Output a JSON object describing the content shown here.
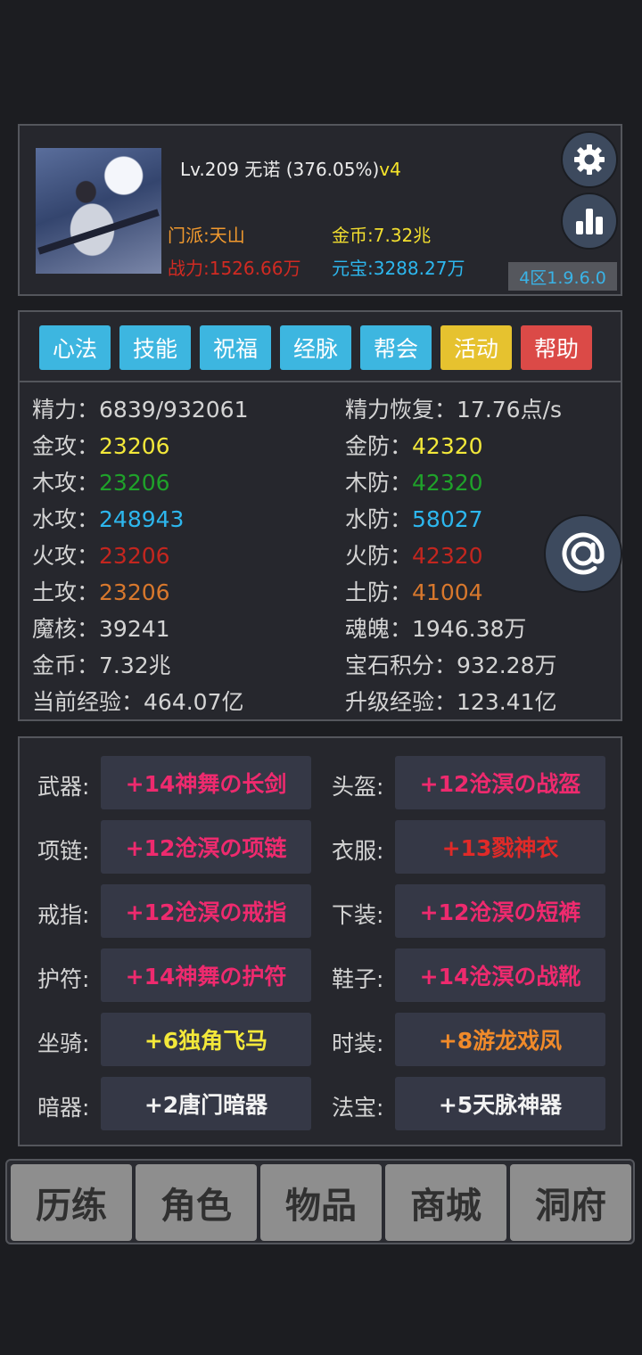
{
  "header": {
    "level": "Lv.209",
    "name": "无诺",
    "exp_pct": "(376.05%)",
    "version_tag": "v4",
    "sect": "门派:天山",
    "power": "战力:1526.66万",
    "gold": "金币:7.32兆",
    "ingot": "元宝:3288.27万",
    "server": "4区1.9.6.0"
  },
  "tabs": [
    {
      "label": "心法",
      "color": "#3db6e0"
    },
    {
      "label": "技能",
      "color": "#3db6e0"
    },
    {
      "label": "祝福",
      "color": "#3db6e0"
    },
    {
      "label": "经脉",
      "color": "#3db6e0"
    },
    {
      "label": "帮会",
      "color": "#3db6e0"
    },
    {
      "label": "活动",
      "color": "#e6c22f"
    },
    {
      "label": "帮助",
      "color": "#db4a47"
    }
  ],
  "stats": [
    {
      "label": "精力：",
      "value": "6839/932061",
      "color": "#d4d4d4"
    },
    {
      "label": "精力恢复：",
      "value": "17.76点/s",
      "color": "#d4d4d4"
    },
    {
      "label": "金攻：",
      "value": "23206",
      "color": "#f3e83a"
    },
    {
      "label": "金防：",
      "value": "42320",
      "color": "#f3e83a"
    },
    {
      "label": "木攻：",
      "value": "23206",
      "color": "#1fa22a"
    },
    {
      "label": "木防：",
      "value": "42320",
      "color": "#1fa22a"
    },
    {
      "label": "水攻：",
      "value": "248943",
      "color": "#2db7ee"
    },
    {
      "label": "水防：",
      "value": "58027",
      "color": "#2db7ee"
    },
    {
      "label": "火攻：",
      "value": "23206",
      "color": "#c3261f"
    },
    {
      "label": "火防：",
      "value": "42320",
      "color": "#c3261f"
    },
    {
      "label": "土攻：",
      "value": "23206",
      "color": "#d8782d"
    },
    {
      "label": "土防：",
      "value": "41004",
      "color": "#d8782d"
    },
    {
      "label": "魔核：",
      "value": "39241",
      "color": "#d4d4d4"
    },
    {
      "label": "魂魄：",
      "value": "1946.38万",
      "color": "#d4d4d4"
    },
    {
      "label": "金币：",
      "value": "7.32兆",
      "color": "#d4d4d4"
    },
    {
      "label": "宝石积分：",
      "value": "932.28万",
      "color": "#d4d4d4"
    },
    {
      "label": "当前经验：",
      "value": "464.07亿",
      "color": "#d4d4d4"
    },
    {
      "label": "升级经验：",
      "value": "123.41亿",
      "color": "#d4d4d4"
    }
  ],
  "equipment": [
    {
      "slot": "武器:",
      "item": "+14神舞の长剑",
      "color": "#ee2a6e"
    },
    {
      "slot": "头盔:",
      "item": "+12沧溟の战盔",
      "color": "#ee2a6e"
    },
    {
      "slot": "项链:",
      "item": "+12沧溟の项链",
      "color": "#ee2a6e"
    },
    {
      "slot": "衣服:",
      "item": "+13戮神衣",
      "color": "#e02a28"
    },
    {
      "slot": "戒指:",
      "item": "+12沧溟の戒指",
      "color": "#ee2a6e"
    },
    {
      "slot": "下装:",
      "item": "+12沧溟の短裤",
      "color": "#ee2a6e"
    },
    {
      "slot": "护符:",
      "item": "+14神舞の护符",
      "color": "#ee2a6e"
    },
    {
      "slot": "鞋子:",
      "item": "+14沧溟の战靴",
      "color": "#ee2a6e"
    },
    {
      "slot": "坐骑:",
      "item": "+6独角飞马",
      "color": "#f3e83a"
    },
    {
      "slot": "时装:",
      "item": "+8游龙戏凤",
      "color": "#f08a2a"
    },
    {
      "slot": "暗器:",
      "item": "+2唐门暗器",
      "color": "#f2f2f2"
    },
    {
      "slot": "法宝:",
      "item": "+5天脉神器",
      "color": "#f2f2f2"
    }
  ],
  "nav": [
    "历练",
    "角色",
    "物品",
    "商城",
    "洞府"
  ]
}
